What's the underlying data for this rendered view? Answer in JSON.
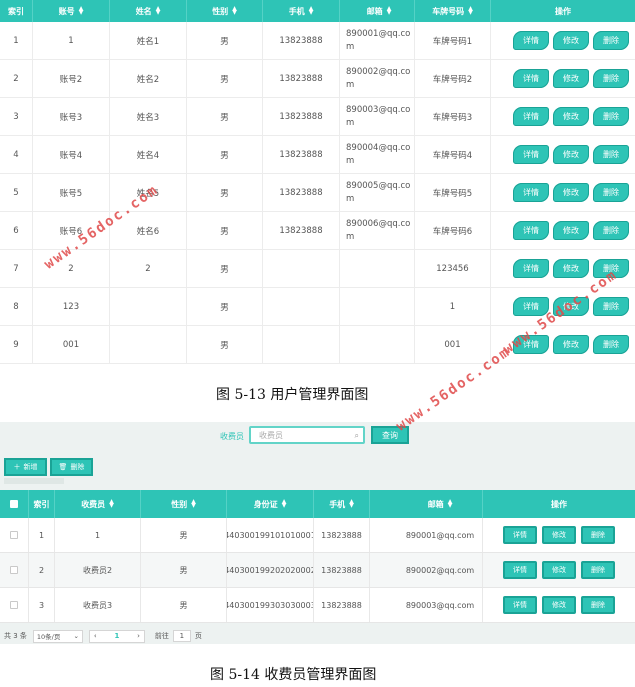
{
  "table1": {
    "headers": {
      "index": "索引",
      "account": "账号",
      "name": "姓名",
      "sex": "性别",
      "phone": "手机",
      "email": "邮箱",
      "plate": "车牌号码",
      "ops": "操作"
    },
    "buttons": {
      "detail": "详情",
      "edit": "修改",
      "delete": "删除"
    },
    "rows": [
      {
        "index": "1",
        "account": "1",
        "name": "姓名1",
        "sex": "男",
        "phone": "13823888",
        "email": "890001@qq.com",
        "plate": "车牌号码1"
      },
      {
        "index": "2",
        "account": "账号2",
        "name": "姓名2",
        "sex": "男",
        "phone": "13823888",
        "email": "890002@qq.com",
        "plate": "车牌号码2"
      },
      {
        "index": "3",
        "account": "账号3",
        "name": "姓名3",
        "sex": "男",
        "phone": "13823888",
        "email": "890003@qq.com",
        "plate": "车牌号码3"
      },
      {
        "index": "4",
        "account": "账号4",
        "name": "姓名4",
        "sex": "男",
        "phone": "13823888",
        "email": "890004@qq.com",
        "plate": "车牌号码4"
      },
      {
        "index": "5",
        "account": "账号5",
        "name": "姓名5",
        "sex": "男",
        "phone": "13823888",
        "email": "890005@qq.com",
        "plate": "车牌号码5"
      },
      {
        "index": "6",
        "account": "账号6",
        "name": "姓名6",
        "sex": "男",
        "phone": "13823888",
        "email": "890006@qq.com",
        "plate": "车牌号码6"
      },
      {
        "index": "7",
        "account": "2",
        "name": "2",
        "sex": "男",
        "phone": "",
        "email": "",
        "plate": "123456"
      },
      {
        "index": "8",
        "account": "123",
        "name": "",
        "sex": "男",
        "phone": "",
        "email": "",
        "plate": "1"
      },
      {
        "index": "9",
        "account": "001",
        "name": "",
        "sex": "男",
        "phone": "",
        "email": "",
        "plate": "001"
      }
    ]
  },
  "caption1": "图 5-13 用户管理界面图",
  "table2": {
    "search": {
      "label": "收费员",
      "placeholder": "收费员",
      "button": "查询"
    },
    "toolbar": {
      "add": "新增",
      "delete": "删除"
    },
    "headers": {
      "index": "索引",
      "name": "收费员",
      "sex": "性别",
      "id_card": "身份证",
      "phone": "手机",
      "email": "邮箱",
      "ops": "操作"
    },
    "buttons": {
      "detail": "详情",
      "edit": "修改",
      "delete": "删除"
    },
    "rows": [
      {
        "index": "1",
        "name": "1",
        "sex": "男",
        "id_card": "440300199101010001",
        "phone": "13823888",
        "email": "890001@qq.com"
      },
      {
        "index": "2",
        "name": "收费员2",
        "sex": "男",
        "id_card": "440300199202020002",
        "phone": "13823888",
        "email": "890002@qq.com"
      },
      {
        "index": "3",
        "name": "收费员3",
        "sex": "男",
        "id_card": "440300199303030003",
        "phone": "13823888",
        "email": "890003@qq.com"
      }
    ],
    "pager": {
      "total": "共 3 条",
      "page_size": "10条/页",
      "current": "1",
      "goto": "前往",
      "goto_value": "1",
      "unit": "页"
    }
  },
  "caption2": "图 5-14 收费员管理界面图",
  "watermark": "www.56doc.com",
  "colors": {
    "accent": "#2ec4b6",
    "accent_dark": "#1aa396",
    "watermark": "#e04a4a"
  }
}
